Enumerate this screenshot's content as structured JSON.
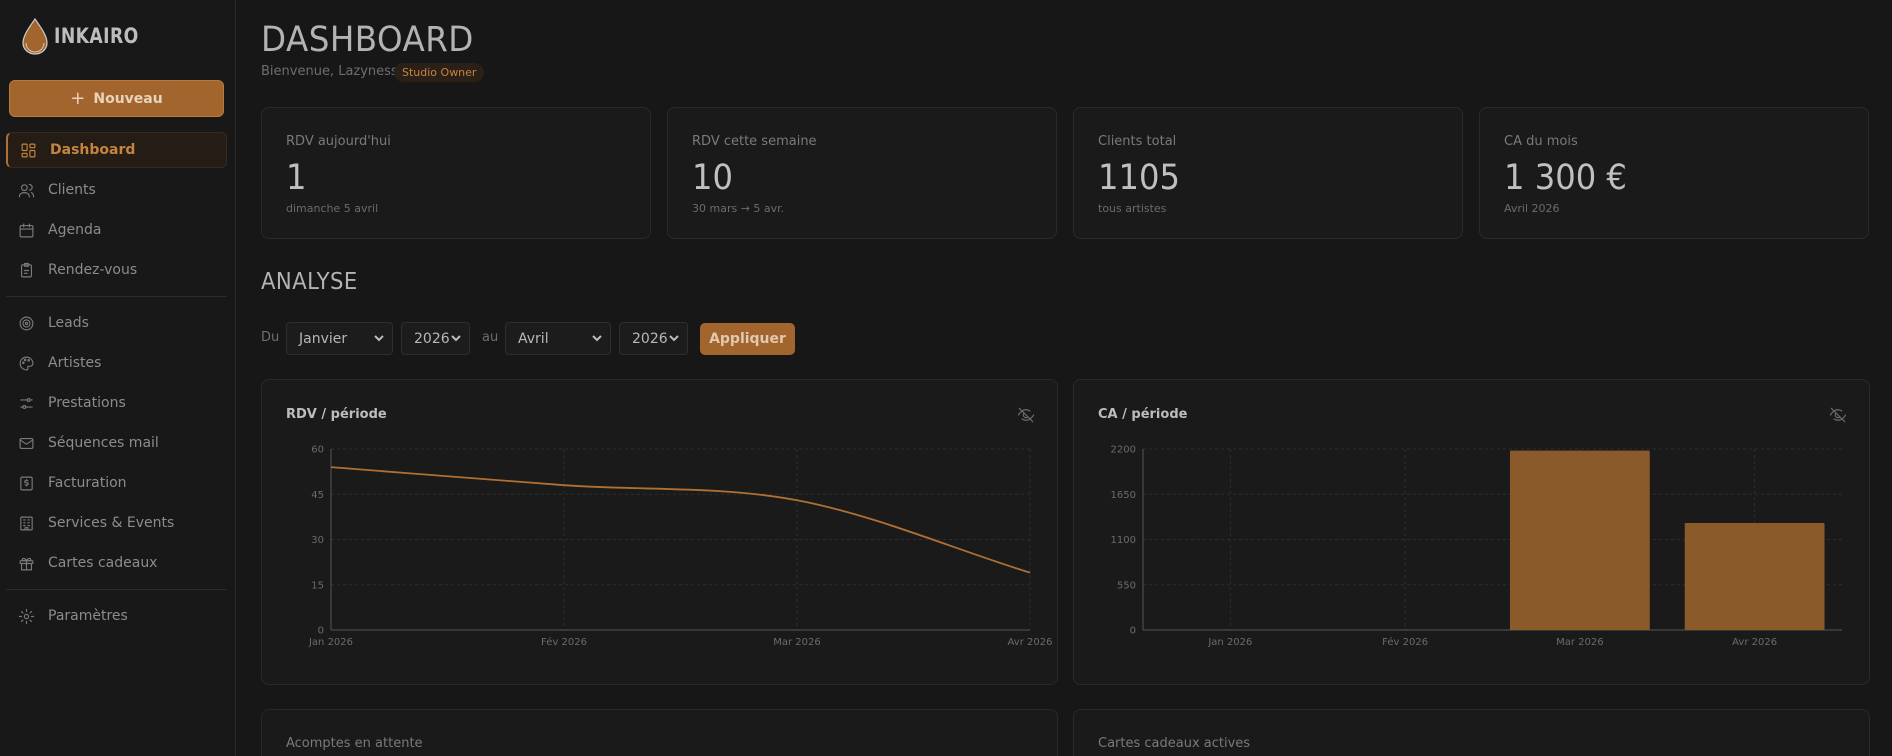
{
  "app": {
    "logo_text": "INKAIRO"
  },
  "sidebar": {
    "new_button": "Nouveau",
    "items": [
      {
        "label": "Dashboard",
        "icon": "dashboard-icon",
        "active": true
      },
      {
        "label": "Clients",
        "icon": "users-icon"
      },
      {
        "label": "Agenda",
        "icon": "calendar-icon"
      },
      {
        "label": "Rendez-vous",
        "icon": "clipboard-icon"
      },
      {
        "label": "Leads",
        "icon": "target-icon"
      },
      {
        "label": "Artistes",
        "icon": "palette-icon"
      },
      {
        "label": "Prestations",
        "icon": "sliders-icon"
      },
      {
        "label": "Séquences mail",
        "icon": "mail-icon"
      },
      {
        "label": "Facturation",
        "icon": "invoice-icon"
      },
      {
        "label": "Services & Events",
        "icon": "building-icon"
      },
      {
        "label": "Cartes cadeaux",
        "icon": "gift-icon"
      },
      {
        "label": "Paramètres",
        "icon": "gear-icon"
      }
    ]
  },
  "header": {
    "title": "DASHBOARD",
    "welcome": "Bienvenue, Lazyness",
    "role": "Studio Owner"
  },
  "stats": [
    {
      "label": "RDV aujourd'hui",
      "value": "1",
      "sub": "dimanche 5 avril"
    },
    {
      "label": "RDV cette semaine",
      "value": "10",
      "sub": "30 mars → 5 avr."
    },
    {
      "label": "Clients total",
      "value": "1105",
      "sub": "tous artistes"
    },
    {
      "label": "CA du mois",
      "value": "1 300 €",
      "sub": "Avril 2026"
    }
  ],
  "analyse": {
    "title": "ANALYSE",
    "from_label": "Du",
    "to_label": "au",
    "from_month": "Janvier",
    "from_year": "2026",
    "to_month": "Avril",
    "to_year": "2026",
    "apply": "Appliquer"
  },
  "colors": {
    "accent": "#a3652e",
    "accent_text": "#c5843f",
    "line": "#b06f33",
    "bar": "#8b5a2b"
  },
  "chart_data": [
    {
      "type": "line",
      "title": "RDV / période",
      "categories": [
        "Jan 2026",
        "Fév 2026",
        "Mar 2026",
        "Avr 2026"
      ],
      "values": [
        54,
        48,
        43,
        19
      ],
      "y_ticks": [
        "0",
        "15",
        "30",
        "45",
        "60"
      ],
      "ylim": [
        0,
        60
      ],
      "grid": true
    },
    {
      "type": "bar",
      "title": "CA / période",
      "categories": [
        "Jan 2026",
        "Fév 2026",
        "Mar 2026",
        "Avr 2026"
      ],
      "values": [
        0,
        0,
        2180,
        1300
      ],
      "y_ticks": [
        "0",
        "550",
        "1100",
        "1650",
        "2200"
      ],
      "ylim": [
        0,
        2200
      ],
      "grid": true
    }
  ],
  "bottom_cards": [
    {
      "label": "Acomptes en attente"
    },
    {
      "label": "Cartes cadeaux actives"
    }
  ]
}
